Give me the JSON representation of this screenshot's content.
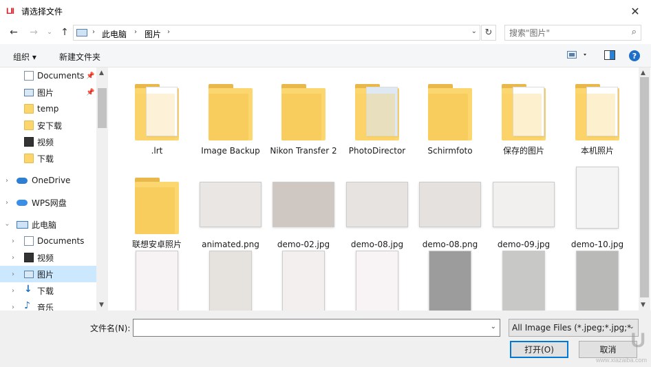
{
  "window": {
    "title": "请选择文件",
    "logo_text": "LII"
  },
  "address": {
    "crumbs": [
      "此电脑",
      "图片"
    ],
    "search_placeholder": "搜索\"图片\""
  },
  "toolbar": {
    "organize": "组织 ▾",
    "new_folder": "新建文件夹"
  },
  "sidebar": {
    "items": [
      {
        "label": "Documents",
        "icon": "document-icon",
        "pinned": true
      },
      {
        "label": "图片",
        "icon": "pictures-icon",
        "pinned": true
      },
      {
        "label": "temp",
        "icon": "folder-icon"
      },
      {
        "label": "安下载",
        "icon": "folder-icon"
      },
      {
        "label": "视频",
        "icon": "video-icon"
      },
      {
        "label": "下载",
        "icon": "folder-icon"
      },
      {
        "label": "OneDrive",
        "icon": "cloud-icon"
      },
      {
        "label": "WPS网盘",
        "icon": "cloud-icon"
      },
      {
        "label": "此电脑",
        "icon": "computer-icon"
      },
      {
        "label": "Documents",
        "icon": "document-icon"
      },
      {
        "label": "视频",
        "icon": "video-icon"
      },
      {
        "label": "图片",
        "icon": "pictures-icon",
        "selected": true
      },
      {
        "label": "下载",
        "icon": "download-icon"
      },
      {
        "label": "音乐",
        "icon": "music-icon"
      }
    ]
  },
  "files": [
    {
      "name": ".lrt",
      "type": "folder"
    },
    {
      "name": "Image Backup",
      "type": "folder"
    },
    {
      "name": "Nikon Transfer 2",
      "type": "folder"
    },
    {
      "name": "PhotoDirector",
      "type": "folder"
    },
    {
      "name": "Schirmfoto",
      "type": "folder"
    },
    {
      "name": "保存的图片",
      "type": "folder"
    },
    {
      "name": "本机照片",
      "type": "folder"
    },
    {
      "name": "联想安卓照片",
      "type": "folder"
    },
    {
      "name": "animated.png",
      "type": "image"
    },
    {
      "name": "demo-02.jpg",
      "type": "image"
    },
    {
      "name": "demo-08.jpg",
      "type": "image"
    },
    {
      "name": "demo-08.png",
      "type": "image"
    },
    {
      "name": "demo-09.jpg",
      "type": "image"
    },
    {
      "name": "demo-10.jpg",
      "type": "document"
    },
    {
      "name": "",
      "type": "document"
    },
    {
      "name": "",
      "type": "document"
    },
    {
      "name": "",
      "type": "document"
    },
    {
      "name": "",
      "type": "document"
    },
    {
      "name": "",
      "type": "document"
    },
    {
      "name": "",
      "type": "document"
    },
    {
      "name": "",
      "type": "document"
    }
  ],
  "footer": {
    "filename_label": "文件名(N):",
    "filename_value": "",
    "filter_label": "All Image Files (*.jpeg;*.jpg;*",
    "open_button": "打开(O)",
    "cancel_button": "取消"
  },
  "watermark": {
    "main": "U",
    "sub": "www.xiazaiba.com"
  }
}
